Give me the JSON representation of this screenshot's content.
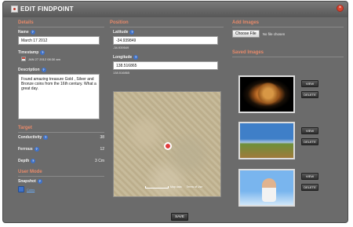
{
  "window": {
    "title": "EDIT FINDPOINT",
    "close_symbol": "×"
  },
  "details": {
    "heading": "Details",
    "name_label": "Name",
    "name_value": "March 17 2012",
    "timestamp_label": "Timestamp",
    "timestamp_value": "JAN 27 2012 08:30 am",
    "description_label": "Description",
    "description_value": "Found amazing treasure Gold , Silver and Bronze coins from the 16th century. What a great day."
  },
  "target": {
    "heading": "Target",
    "conductivity_label": "Conductivity",
    "conductivity_value": "38",
    "ferrous_label": "Ferrous",
    "ferrous_value": "12",
    "depth_label": "Depth",
    "depth_value": "3 Cm"
  },
  "user_mode": {
    "heading": "User Mode",
    "snapshot_label": "Snapshot",
    "snapshot_value": "Coins"
  },
  "position": {
    "heading": "Position",
    "latitude_label": "Latitude",
    "latitude_value": "-34.939849",
    "latitude_sub": "-34.939549",
    "longitude_label": "Longitude",
    "longitude_value": "138.516865",
    "longitude_sub": "138.516865",
    "map_caption_1": "Map data",
    "map_caption_2": "Terms of Use"
  },
  "images": {
    "add_heading": "Add Images",
    "choose_button": "Choose File",
    "choose_status": "No file chosen",
    "saved_heading": "Saved Images",
    "items": [
      {
        "view_label": "VIEW",
        "delete_label": "DELETE"
      },
      {
        "view_label": "VIEW",
        "delete_label": "DELETE"
      },
      {
        "view_label": "VIEW",
        "delete_label": "DELETE"
      }
    ]
  },
  "footer": {
    "save_label": "SAVE"
  },
  "help_symbol": "?"
}
